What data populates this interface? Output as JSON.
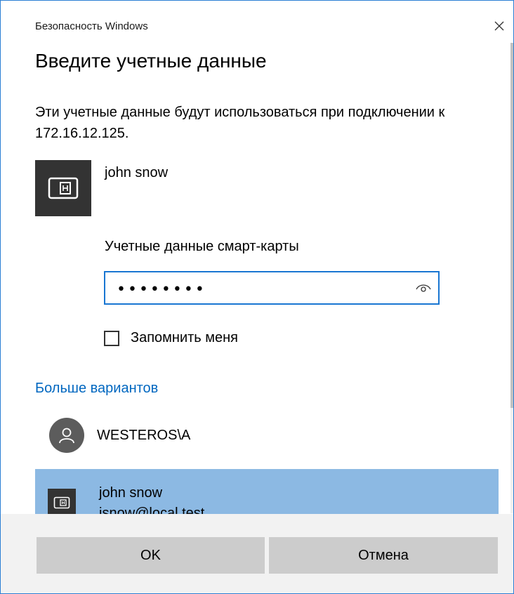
{
  "window": {
    "title": "Безопасность Windows",
    "close_icon": "close-icon"
  },
  "dialog": {
    "heading": "Введите учетные данные",
    "description": "Эти учетные данные будут использоваться при подключении к 172.16.12.125."
  },
  "account": {
    "icon": "smart-card-icon",
    "name": "john snow"
  },
  "credential": {
    "label": "Учетные данные смарт-карты",
    "value": "••••••••",
    "reveal_icon": "eye-icon"
  },
  "remember": {
    "label": "Запомнить меня",
    "checked": false
  },
  "more_options": {
    "link_label": "Больше вариантов",
    "options": [
      {
        "icon": "user-icon",
        "name": "WESTEROS\\A"
      },
      {
        "icon": "smart-card-icon",
        "name": "john snow",
        "email": "jsnow@local.test",
        "selected": true
      }
    ]
  },
  "buttons": {
    "ok": "OK",
    "cancel": "Отмена"
  },
  "colors": {
    "accent": "#0067c0",
    "field_border": "#1976d2",
    "selected_row": "#8cb9e3",
    "tile": "#333333",
    "button": "#cccccc",
    "footer": "#f2f2f2"
  }
}
